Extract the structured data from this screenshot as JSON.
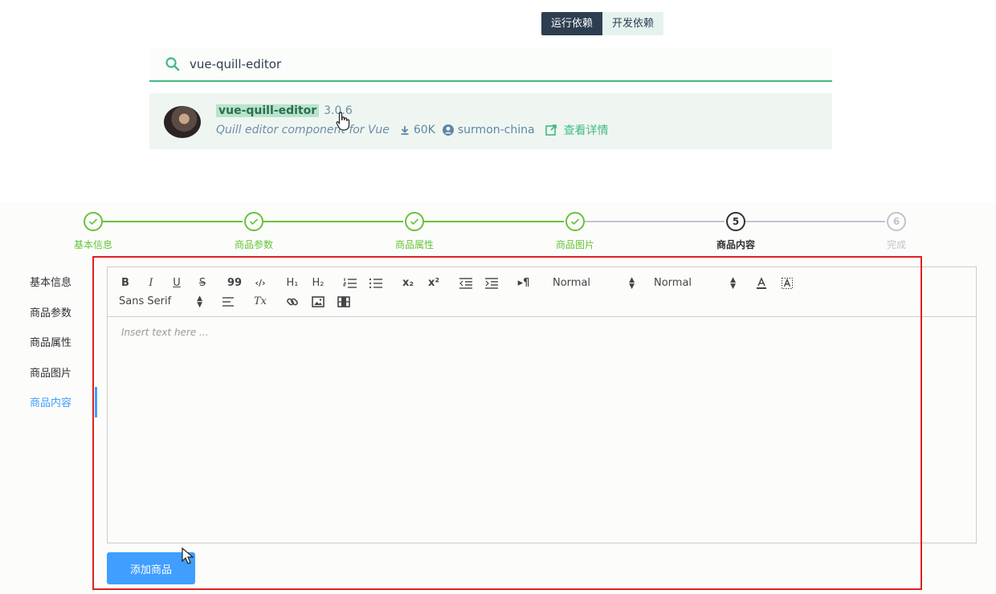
{
  "deps": {
    "tabs": [
      {
        "label": "运行依赖",
        "active": true
      },
      {
        "label": "开发依赖",
        "active": false
      }
    ]
  },
  "search": {
    "value": "vue-quill-editor",
    "placeholder": ""
  },
  "result": {
    "name": "vue-quill-editor",
    "version": "3.0.6",
    "description": "Quill editor component for Vue",
    "downloads": "60K",
    "author": "surmon-china",
    "details_label": "查看详情",
    "icons": [
      "download-icon",
      "user-icon",
      "external-link-icon"
    ]
  },
  "steps": [
    {
      "index": "1",
      "label": "基本信息",
      "status": "done"
    },
    {
      "index": "2",
      "label": "商品参数",
      "status": "done"
    },
    {
      "index": "3",
      "label": "商品属性",
      "status": "done"
    },
    {
      "index": "4",
      "label": "商品图片",
      "status": "done"
    },
    {
      "index": "5",
      "label": "商品内容",
      "status": "current"
    },
    {
      "index": "6",
      "label": "完成",
      "status": "todo"
    }
  ],
  "side_tabs": [
    {
      "label": "基本信息",
      "active": false
    },
    {
      "label": "商品参数",
      "active": false
    },
    {
      "label": "商品属性",
      "active": false
    },
    {
      "label": "商品图片",
      "active": false
    },
    {
      "label": "商品内容",
      "active": true
    }
  ],
  "editor": {
    "toolbar": {
      "bold": "B",
      "italic": "I",
      "underline": "U",
      "strike": "S",
      "blockquote": "99",
      "code": "‹/›",
      "h1": "H₁",
      "h2": "H₂",
      "subscript": "x₂",
      "superscript": "x²",
      "direction": "▸¶",
      "size_picker": "Normal",
      "header_picker": "Normal",
      "font_picker": "Sans Serif",
      "clean": "Tx"
    },
    "placeholder": "Insert text here ..."
  },
  "add_button_label": "添加商品",
  "colors": {
    "accent_green": "#42b983",
    "steps_done": "#67c23a",
    "primary_blue": "#409eff",
    "highlight_red": "#e02020",
    "dark_tab": "#2c3e50"
  }
}
